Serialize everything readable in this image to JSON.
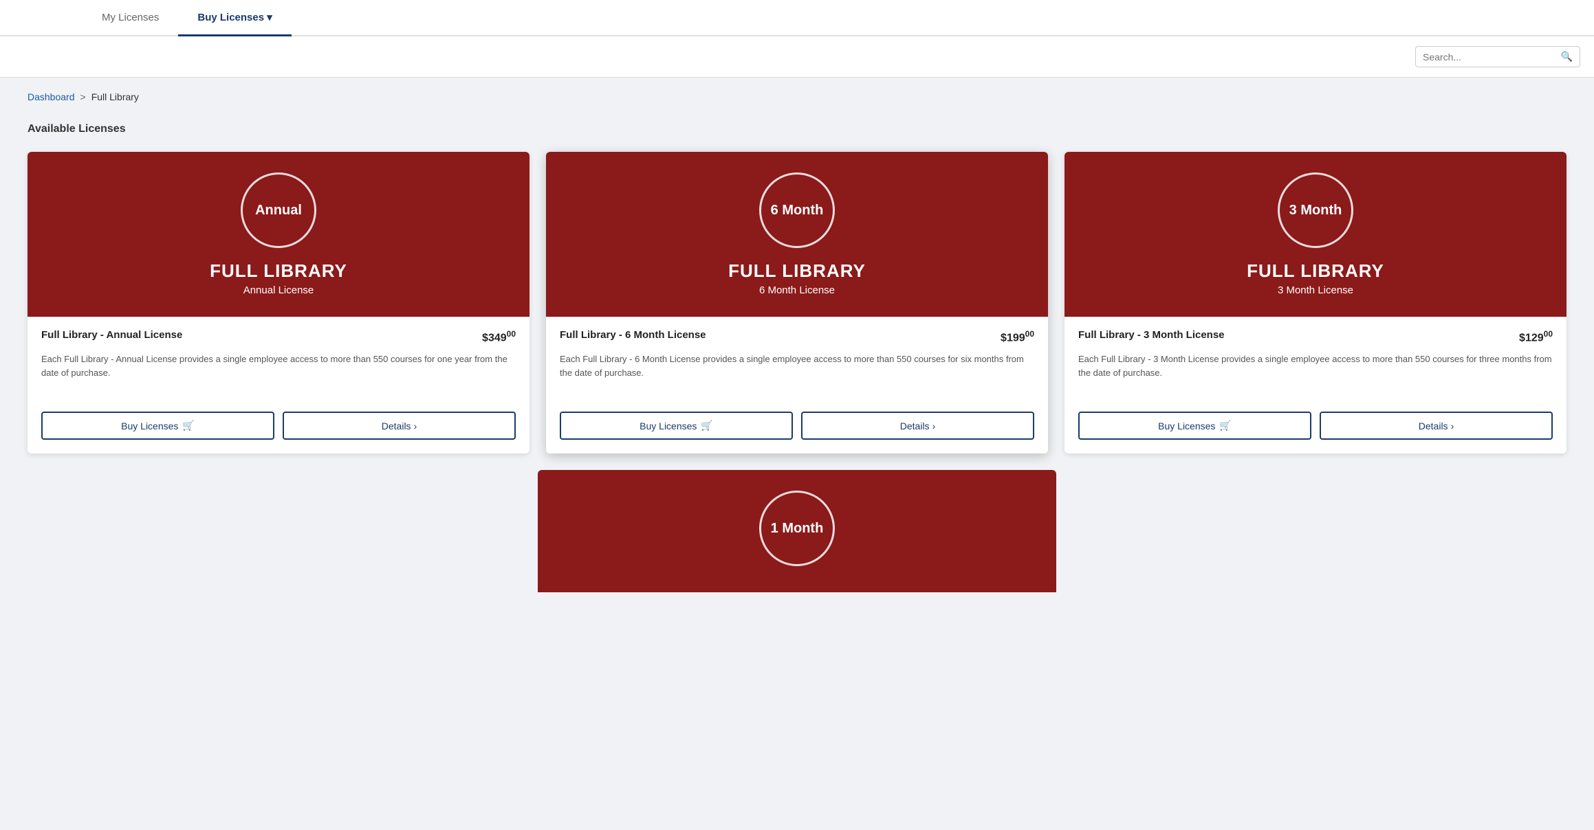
{
  "nav": {
    "tabs": [
      {
        "id": "my-licenses",
        "label": "My Licenses",
        "active": false
      },
      {
        "id": "buy-licenses",
        "label": "Buy Licenses ▾",
        "active": true
      }
    ]
  },
  "search": {
    "placeholder": "Search..."
  },
  "breadcrumb": {
    "home": "Dashboard",
    "separator": ">",
    "current": "Full Library"
  },
  "section_title": "Available Licenses",
  "cards": [
    {
      "id": "annual",
      "circle_text": "Annual",
      "library_title": "FULL LIBRARY",
      "license_subtitle": "Annual License",
      "license_name": "Full Library - Annual License",
      "price_main": "$349",
      "price_cents": "00",
      "description": "Each Full Library - Annual License provides a single employee access to more than 550 courses for one year from the date of purchase.",
      "buy_label": "Buy Licenses",
      "details_label": "Details"
    },
    {
      "id": "6month",
      "circle_text": "6 Month",
      "library_title": "FULL LIBRARY",
      "license_subtitle": "6 Month License",
      "license_name": "Full Library - 6 Month License",
      "price_main": "$199",
      "price_cents": "00",
      "description": "Each Full Library - 6 Month License provides a single employee access to more than 550 courses for six months from the date of purchase.",
      "buy_label": "Buy Licenses",
      "details_label": "Details"
    },
    {
      "id": "3month",
      "circle_text": "3 Month",
      "library_title": "FULL LIBRARY",
      "license_subtitle": "3 Month License",
      "license_name": "Full Library - 3 Month License",
      "price_main": "$129",
      "price_cents": "00",
      "description": "Each Full Library - 3 Month License provides a single employee access to more than 550 courses for three months from the date of purchase.",
      "buy_label": "Buy Licenses",
      "details_label": "Details"
    }
  ],
  "partial_card": {
    "circle_text": "1 Month"
  }
}
